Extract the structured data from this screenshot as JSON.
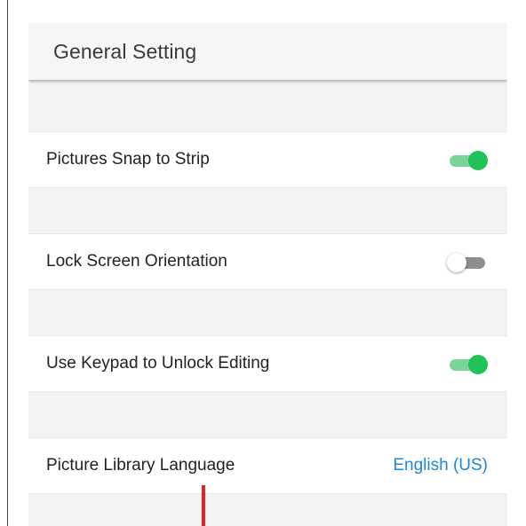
{
  "colors": {
    "toggle_on_track": "#7bd39a",
    "toggle_on_knob": "#21c25a",
    "toggle_off_track": "#8f8f8f",
    "link_value": "#1f86d3",
    "cursor_line": "#e22026"
  },
  "header": {
    "title": "General Setting"
  },
  "settings": {
    "snap_to_strip": {
      "label": "Pictures Snap to Strip",
      "state": "on"
    },
    "lock_orientation": {
      "label": "Lock Screen Orientation",
      "state": "off"
    },
    "keypad_unlock": {
      "label": "Use Keypad to Unlock Editing",
      "state": "on"
    },
    "library_language": {
      "label": "Picture Library Language",
      "value": "English (US)"
    }
  }
}
